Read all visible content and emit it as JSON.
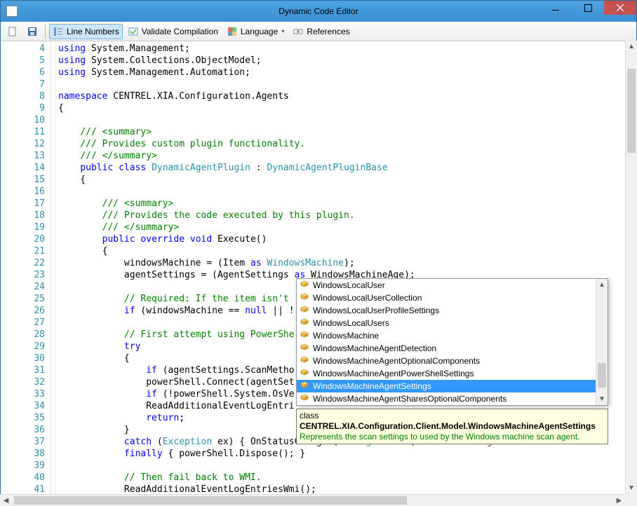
{
  "window": {
    "title": "Dynamic Code Editor"
  },
  "toolbar": {
    "new": "",
    "save": "",
    "line_numbers": "Line Numbers",
    "validate": "Validate Compilation",
    "language": "Language",
    "references": "References"
  },
  "gutter": {
    "start": 4,
    "end": 41
  },
  "code_lines": [
    {
      "t": [
        {
          "c": "kw",
          "s": "using"
        },
        {
          "s": " System.Management;"
        }
      ]
    },
    {
      "t": [
        {
          "c": "kw",
          "s": "using"
        },
        {
          "s": " System.Collections.ObjectModel;"
        }
      ]
    },
    {
      "t": [
        {
          "c": "kw",
          "s": "using"
        },
        {
          "s": " System.Management.Automation;"
        }
      ]
    },
    {
      "t": []
    },
    {
      "t": [
        {
          "c": "kw",
          "s": "namespace"
        },
        {
          "s": " CENTREL.XIA.Configuration.Agents"
        }
      ]
    },
    {
      "t": [
        {
          "s": "{"
        }
      ]
    },
    {
      "t": []
    },
    {
      "t": [
        {
          "s": "    "
        },
        {
          "c": "cm",
          "s": "/// <summary>"
        }
      ]
    },
    {
      "t": [
        {
          "s": "    "
        },
        {
          "c": "cm",
          "s": "/// Provides custom plugin functionality."
        }
      ]
    },
    {
      "t": [
        {
          "s": "    "
        },
        {
          "c": "cm",
          "s": "/// </summary>"
        }
      ]
    },
    {
      "t": [
        {
          "s": "    "
        },
        {
          "c": "kw",
          "s": "public"
        },
        {
          "s": " "
        },
        {
          "c": "kw",
          "s": "class"
        },
        {
          "s": " "
        },
        {
          "c": "type",
          "s": "DynamicAgentPlugin"
        },
        {
          "s": " : "
        },
        {
          "c": "type",
          "s": "DynamicAgentPluginBase"
        }
      ]
    },
    {
      "t": [
        {
          "s": "    {"
        }
      ]
    },
    {
      "t": []
    },
    {
      "t": [
        {
          "s": "        "
        },
        {
          "c": "cm",
          "s": "/// <summary>"
        }
      ]
    },
    {
      "t": [
        {
          "s": "        "
        },
        {
          "c": "cm",
          "s": "/// Provides the code executed by this plugin."
        }
      ]
    },
    {
      "t": [
        {
          "s": "        "
        },
        {
          "c": "cm",
          "s": "/// </summary>"
        }
      ]
    },
    {
      "t": [
        {
          "s": "        "
        },
        {
          "c": "kw",
          "s": "public"
        },
        {
          "s": " "
        },
        {
          "c": "kw",
          "s": "override"
        },
        {
          "s": " "
        },
        {
          "c": "kw",
          "s": "void"
        },
        {
          "s": " Execute()"
        }
      ]
    },
    {
      "t": [
        {
          "s": "        {"
        }
      ]
    },
    {
      "t": [
        {
          "s": "            windowsMachine = (Item "
        },
        {
          "c": "kw",
          "s": "as"
        },
        {
          "s": " "
        },
        {
          "c": "type",
          "s": "WindowsMachine"
        },
        {
          "s": ");"
        }
      ]
    },
    {
      "t": [
        {
          "s": "            agentSettings = (AgentSettings "
        },
        {
          "c": "kw",
          "s": "as"
        },
        {
          "s": " WindowsMachineAge);"
        }
      ]
    },
    {
      "t": []
    },
    {
      "t": [
        {
          "s": "            "
        },
        {
          "c": "cm",
          "s": "// Required: If the item isn't"
        }
      ]
    },
    {
      "t": [
        {
          "s": "            "
        },
        {
          "c": "kw",
          "s": "if"
        },
        {
          "s": " (windowsMachine == "
        },
        {
          "c": "kw",
          "s": "null"
        },
        {
          "s": " || !"
        }
      ]
    },
    {
      "t": []
    },
    {
      "t": [
        {
          "s": "            "
        },
        {
          "c": "cm",
          "s": "// First attempt using PowerShe"
        }
      ]
    },
    {
      "t": [
        {
          "s": "            "
        },
        {
          "c": "kw",
          "s": "try"
        }
      ]
    },
    {
      "t": [
        {
          "s": "            {"
        }
      ]
    },
    {
      "t": [
        {
          "s": "                "
        },
        {
          "c": "kw",
          "s": "if"
        },
        {
          "s": " (agentSettings.ScanMetho"
        }
      ]
    },
    {
      "t": [
        {
          "s": "                powerShell.Connect(agentSet"
        }
      ]
    },
    {
      "t": [
        {
          "s": "                "
        },
        {
          "c": "kw",
          "s": "if"
        },
        {
          "s": " (!powerShell.System.OsVe"
        }
      ]
    },
    {
      "t": [
        {
          "s": "                ReadAdditionalEventLogEntri"
        }
      ]
    },
    {
      "t": [
        {
          "s": "                "
        },
        {
          "c": "kw",
          "s": "return"
        },
        {
          "s": ";"
        }
      ]
    },
    {
      "t": [
        {
          "s": "            }"
        }
      ]
    },
    {
      "t": [
        {
          "s": "            "
        },
        {
          "c": "kw",
          "s": "catch"
        },
        {
          "s": " ("
        },
        {
          "c": "type",
          "s": "Exception"
        },
        {
          "s": " ex) { OnStatusChanged("
        },
        {
          "c": "type",
          "s": "String"
        },
        {
          "s": ".Format("
        },
        {
          "c": "str",
          "s": "\"Error reading additional entries f"
        }
      ]
    },
    {
      "t": [
        {
          "s": "            "
        },
        {
          "c": "kw",
          "s": "finally"
        },
        {
          "s": " { powerShell.Dispose(); }"
        }
      ]
    },
    {
      "t": []
    },
    {
      "t": [
        {
          "s": "            "
        },
        {
          "c": "cm",
          "s": "// Then fail back to WMI."
        }
      ]
    },
    {
      "t": [
        {
          "s": "            ReadAdditionalEventLogEntriesWmi();"
        }
      ]
    }
  ],
  "intellisense": {
    "items": [
      "WindowsLocalUser",
      "WindowsLocalUserCollection",
      "WindowsLocalUserProfileSettings",
      "WindowsLocalUsers",
      "WindowsMachine",
      "WindowsMachineAgentDetection",
      "WindowsMachineAgentOptionalComponents",
      "WindowsMachineAgentPowerShellSettings",
      "WindowsMachineAgentSettings",
      "WindowsMachineAgentSharesOptionalComponents"
    ],
    "selected_index": 8,
    "tooltip_prefix": "class ",
    "tooltip_class": "CENTREL.XIA.Configuration.Client.Model.WindowsMachineAgentSettings",
    "tooltip_desc": "Represents the scan settings to used by the Windows machine scan agent."
  }
}
